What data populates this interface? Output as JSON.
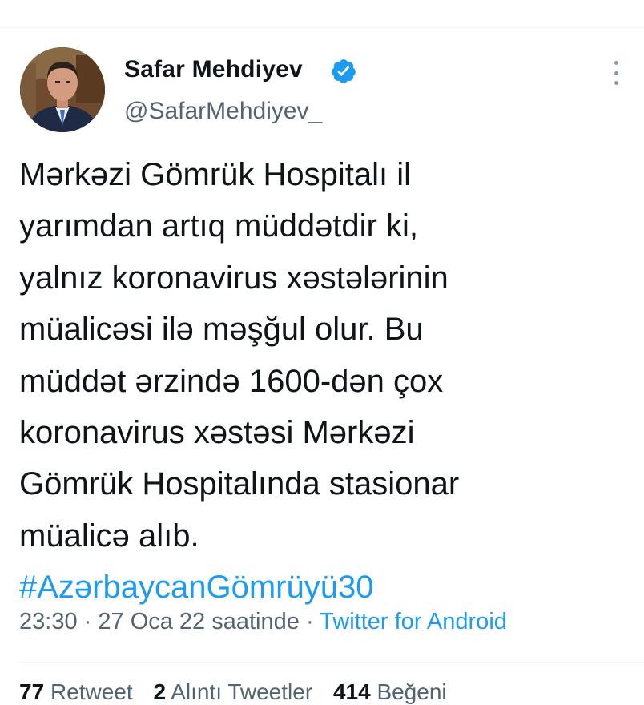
{
  "author": {
    "name": "Safar Mehdiyev",
    "handle": "@SafarMehdiyev_"
  },
  "tweet": {
    "lines": [
      "Mərkəzi Gömrük Hospitalı il",
      "yarımdan artıq müddətdir ki,",
      "yalnız koronavirus xəstələrinin",
      "müalicəsi ilə məşğul olur. Bu",
      "müddət ərzində 1600-dən çox",
      "koronavirus xəstəsi Mərkəzi",
      "Gömrük Hospitalında stasionar",
      "müalicə alıb."
    ],
    "hashtag": "#AzərbaycanGömrüyü30"
  },
  "meta": {
    "time": "23:30",
    "separator": "·",
    "date": "27 Oca 22 saatinde",
    "source": "Twitter for Android"
  },
  "stats": {
    "retweets_count": "77",
    "retweets_label": "Retweet",
    "quotes_count": "2",
    "quotes_label": "Alıntı Tweetler",
    "likes_count": "414",
    "likes_label": "Beğeni"
  },
  "icons": {
    "verified": "verified-badge-icon",
    "more": "more-vertical-icon"
  },
  "colors": {
    "accent": "#1d9bf0",
    "text_primary": "#0f1419",
    "text_secondary": "#536471"
  }
}
